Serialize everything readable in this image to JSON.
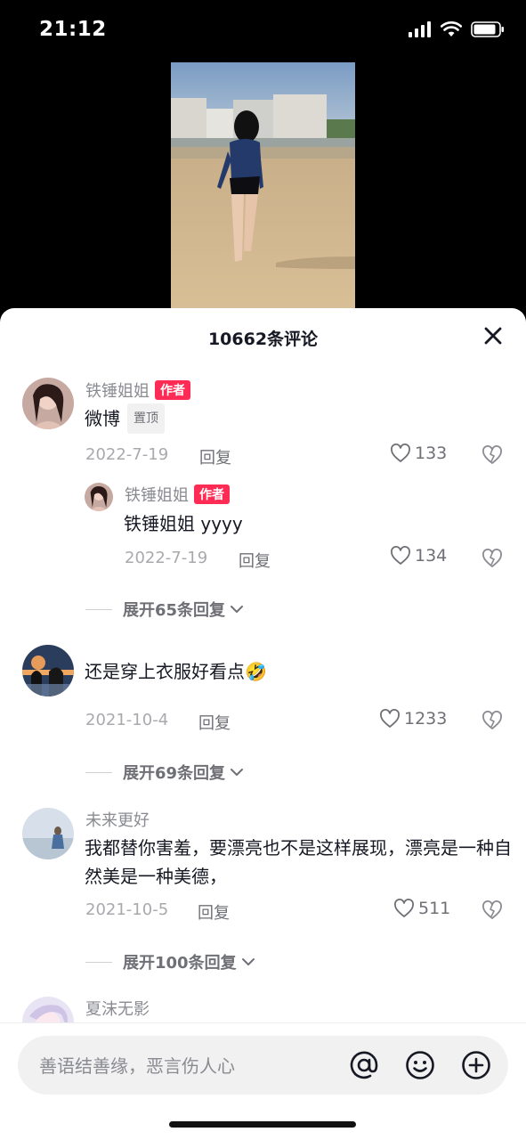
{
  "status_bar": {
    "time": "21:12"
  },
  "comments_panel": {
    "title": "10662条评论",
    "input_placeholder": "善语结善缘，恶言伤人心",
    "author_badge": "作者",
    "pinned_badge": "置顶",
    "reply_label": "回复"
  },
  "comments": [
    {
      "username": "铁锤姐姐",
      "is_author": true,
      "text": "微博",
      "pinned": true,
      "date": "2022-7-19",
      "likes": "133",
      "replies": [
        {
          "username": "铁锤姐姐",
          "is_author": true,
          "text": "铁锤姐姐 yyyy",
          "date": "2022-7-19",
          "likes": "134"
        }
      ],
      "expand_label": "展开65条回复"
    },
    {
      "username": "",
      "text": "还是穿上衣服好看点",
      "emoji": "🤣",
      "date": "2021-10-4",
      "likes": "1233",
      "expand_label": "展开69条回复"
    },
    {
      "username": "未来更好",
      "text": "我都替你害羞，要漂亮也不是这样展现，漂亮是一种自然美是一种美德，",
      "date": "2021-10-5",
      "likes": "511",
      "expand_label": "展开100条回复"
    },
    {
      "username": "夏沫无影"
    }
  ],
  "colors": {
    "accent": "#fe2c55",
    "muted_text": "#8a8b91",
    "background": "#ffffff"
  },
  "icons": [
    "signal-icon",
    "wifi-icon",
    "battery-icon",
    "close-icon",
    "heart-icon",
    "dislike-heart-icon",
    "chevron-down-icon",
    "at-icon",
    "emoji-icon",
    "plus-icon"
  ]
}
